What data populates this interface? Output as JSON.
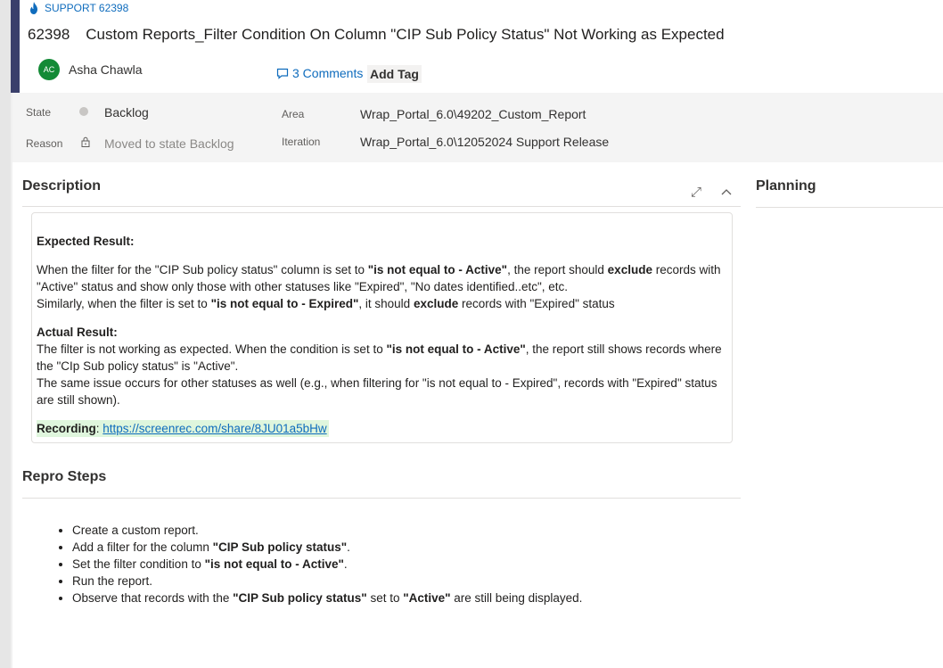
{
  "work_item": {
    "type_label": "SUPPORT 62398",
    "id": "62398",
    "title": "Custom Reports_Filter Condition On Column \"CIP Sub Policy Status\" Not Working as Expected",
    "assignee_initials": "AC",
    "assignee_name": "Asha Chawla",
    "comments_label": "3 Comments",
    "add_tag_label": "Add Tag"
  },
  "fields": {
    "state_label": "State",
    "state_value": "Backlog",
    "reason_label": "Reason",
    "reason_value": "Moved to state Backlog",
    "area_label": "Area",
    "area_value": "Wrap_Portal_6.0\\49202_Custom_Report",
    "iteration_label": "Iteration",
    "iteration_value": "Wrap_Portal_6.0\\12052024 Support Release"
  },
  "sections": {
    "description": "Description",
    "planning": "Planning",
    "repro_steps": "Repro Steps"
  },
  "description": {
    "expected_heading": "Expected Result:",
    "p1_a": "When the filter for the \"CIP Sub policy status\" column is set to ",
    "p1_b": "\"is not equal to - Active\"",
    "p1_c": ", the report should ",
    "p1_d": "exclude",
    "p1_e": " records with \"Active\" status and show only those with other statuses like \"Expired\", \"No dates identified..etc\", etc.",
    "p2_a": "Similarly, when the filter is set to ",
    "p2_b": "\"is not equal to - Expired\"",
    "p2_c": ", it should ",
    "p2_d": "exclude",
    "p2_e": " records with \"Expired\" status",
    "actual_heading": "Actual Result:",
    "p3_a": "The filter is not working as expected. When the condition is set to ",
    "p3_b": "\"is not equal to - Active\"",
    "p3_c": ", the report still shows records where the \"CIp Sub policy status\" is \"Active\".",
    "p4": "The same issue occurs for other statuses as well (e.g., when filtering for \"is not equal to - Expired\", records with \"Expired\" status are still shown).",
    "recording_label": "Recording",
    "recording_sep": ": ",
    "recording_url": "https://screenrec.com/share/8JU01a5bHw"
  },
  "repro": {
    "s1": "Create a custom report.",
    "s2_a": "Add a filter for the column ",
    "s2_b": "\"CIP Sub policy status\"",
    "s2_c": ".",
    "s3_a": "Set the filter condition to ",
    "s3_b": "\"is not equal to - Active\"",
    "s3_c": ".",
    "s4": "Run the report.",
    "s5_a": "Observe that records with the ",
    "s5_b": "\"CIP Sub policy status\"",
    "s5_c": " set to ",
    "s5_d": "\"Active\"",
    "s5_e": " are still being displayed."
  },
  "icons": {
    "type": "flame-icon",
    "comments": "comment-icon",
    "expand": "expand-icon",
    "collapse": "chevron-up-icon",
    "lock": "lock-icon"
  },
  "colors": {
    "accent": "#0f6cbd",
    "avatar": "#138a36",
    "highlight": "#dff6dd"
  }
}
